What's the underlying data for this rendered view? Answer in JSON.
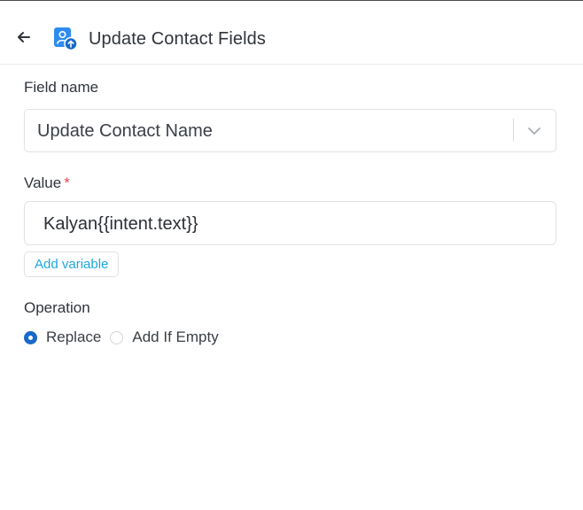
{
  "header": {
    "title": "Update Contact Fields",
    "back_icon": "arrow-left-icon",
    "app_icon": "contact-update-icon"
  },
  "field_name": {
    "label": "Field name",
    "selected_value": "Update Contact Name",
    "chevron_icon": "chevron-down-icon"
  },
  "value": {
    "label": "Value",
    "required_marker": "*",
    "input_value": "Kalyan{{intent.text}}",
    "add_variable_label": "Add variable"
  },
  "operation": {
    "label": "Operation",
    "options": [
      {
        "label": "Replace",
        "checked": true
      },
      {
        "label": "Add If Empty",
        "checked": false
      }
    ]
  },
  "colors": {
    "accent": "#1769c9",
    "link": "#1ea7e1",
    "required": "#e5484d",
    "border": "#dfe2e6",
    "icon_blue": "#2d8cf0"
  }
}
